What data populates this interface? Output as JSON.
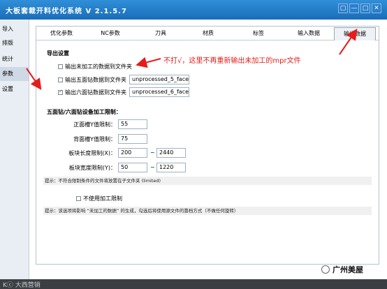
{
  "window": {
    "title": "大板套裁开料优化系统 V 2.1.5.7",
    "controls": [
      "▢",
      "—",
      "□",
      "✕"
    ]
  },
  "sidebar": {
    "items": [
      "导入",
      "排版",
      "统计",
      "参数",
      "设置"
    ],
    "active": "参数"
  },
  "tabs": [
    "优化参数",
    "NC参数",
    "刀具",
    "材质",
    "标签",
    "输入数据",
    "输出数据"
  ],
  "active_tab": "输出数据",
  "export": {
    "title": "导出设置",
    "opt_unprocessed": {
      "label": "输出未加工的数据到文件夹",
      "checked": false
    },
    "opt_five_face": {
      "label": "输出五面钻数据到文件夹",
      "checked": false,
      "value": "unprocessed_5_face"
    },
    "opt_six_face": {
      "label": "输出六面钻数据到文件夹",
      "checked": true,
      "value": "unprocessed_6_face"
    }
  },
  "limits": {
    "title": "五面钻/六面钻设备加工限制：",
    "front_y_label": "正面槽Y值限制：",
    "front_y": "55",
    "back_y_label": "背面槽Y值限制：",
    "back_y": "75",
    "length_label": "板块长度限制(X)：",
    "length_min": "200",
    "length_max": "2440",
    "width_label": "板块宽度限制(Y)：",
    "width_min": "50",
    "width_max": "1220",
    "tilde": "~"
  },
  "hint1": "提示：不符合限制条件的文件将放置在子文件夹 (limited)",
  "no_limit": {
    "label": "不使用加工限制",
    "checked": false
  },
  "hint2": "提示：该选项将影响 “未加工的数据” 的生成，勾选后将使用源文件的靠档方式（不做任何旋转）",
  "annotation": "不打√，这里不再重新输出未加工的mpr文件",
  "watermark": "Kⓒ 大西营销",
  "wechat_name": "广州美屋",
  "colors": {
    "titlebar": "#1f7ac6",
    "annotation": "#e61b1b",
    "sidebar_active": "#cfd9e6"
  }
}
